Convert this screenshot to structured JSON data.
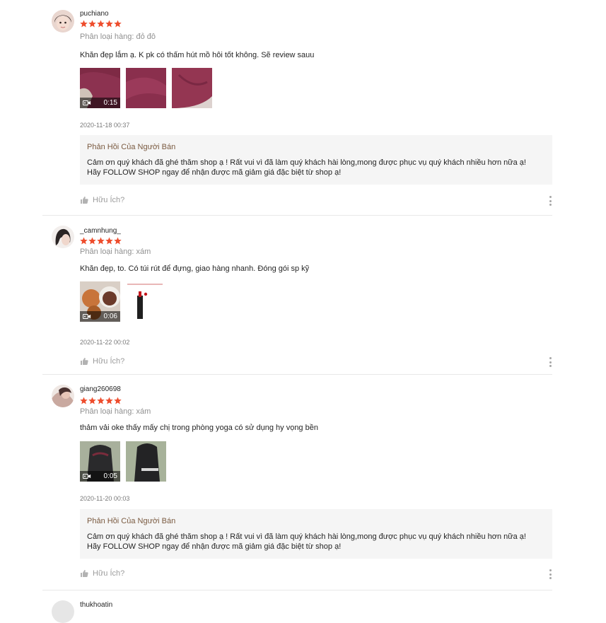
{
  "colors": {
    "star": "#ee4d2d",
    "reply_title": "#7a5a40",
    "reply_bg": "#f5f5f5"
  },
  "reviews": [
    {
      "username": "puchiano",
      "rating": 5,
      "variation": "Phân loại hàng: đỏ đô",
      "comment": "Khăn đẹp lắm ạ. K pk có thấm hút mồ hôi tốt không. Sẽ review sauu",
      "media": [
        {
          "type": "video",
          "duration": "0:15"
        },
        {
          "type": "image"
        },
        {
          "type": "image"
        }
      ],
      "time": "2020-11-18 00:37",
      "reply": {
        "title": "Phản Hồi Của Người Bán",
        "line1": "Cảm ơn quý khách đã ghé thăm shop ạ ! Rất vui vì đã làm quý khách hài lòng,mong được phục vụ quý khách nhiều hơn nữa ạ!",
        "line2": "Hãy FOLLOW SHOP ngay để nhận được mã giảm giá đặc biệt từ shop ạ!"
      },
      "helpful": "Hữu Ích?"
    },
    {
      "username": "_camnhung_",
      "rating": 5,
      "variation": "Phân loại hàng: xám",
      "comment": "Khăn đẹp, to. Có túi rút để đựng, giao hàng nhanh. Đóng gói sp kỹ",
      "media": [
        {
          "type": "video",
          "duration": "0:06"
        },
        {
          "type": "image"
        }
      ],
      "time": "2020-11-22 00:02",
      "helpful": "Hữu Ích?"
    },
    {
      "username": "giang260698",
      "rating": 5,
      "variation": "Phân loại hàng: xám",
      "comment": "thảm vải oke thấy mấy chị trong phòng yoga có sử dụng hy vọng bền",
      "media": [
        {
          "type": "video",
          "duration": "0:05"
        },
        {
          "type": "image"
        }
      ],
      "time": "2020-11-20 00:03",
      "reply": {
        "title": "Phản Hồi Của Người Bán",
        "line1": "Cảm ơn quý khách đã ghé thăm shop ạ ! Rất vui vì đã làm quý khách hài lòng,mong được phục vụ quý khách nhiều hơn nữa ạ!",
        "line2": "Hãy FOLLOW SHOP ngay để nhận được mã giảm giá đặc biệt từ shop ạ!"
      },
      "helpful": "Hữu Ích?"
    },
    {
      "username": "thukhoatin"
    }
  ]
}
